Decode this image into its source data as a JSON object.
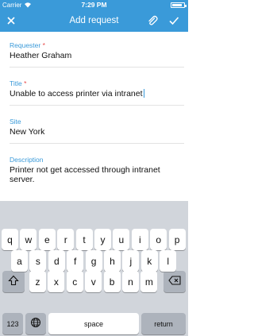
{
  "status_bar": {
    "carrier": "Carrier",
    "time": "7:29 PM",
    "battery_level": 0.85
  },
  "navbar": {
    "title": "Add request",
    "icons": [
      "close-icon",
      "paperclip-icon",
      "checkmark-icon"
    ],
    "accent": "#3a9ad9"
  },
  "form": {
    "requester": {
      "label": "Requester",
      "required_mark": "*",
      "value": "Heather Graham"
    },
    "title": {
      "label": "Title",
      "required_mark": "*",
      "value": "Unable to access printer via intranet"
    },
    "site": {
      "label": "Site",
      "value": "New York"
    },
    "description": {
      "label": "Description",
      "value": "Printer not get accessed through intranet server."
    }
  },
  "keyboard": {
    "row1": [
      "q",
      "w",
      "e",
      "r",
      "t",
      "y",
      "u",
      "i",
      "o",
      "p"
    ],
    "row2": [
      "a",
      "s",
      "d",
      "f",
      "g",
      "h",
      "j",
      "k",
      "l"
    ],
    "row3": [
      "z",
      "x",
      "c",
      "v",
      "b",
      "n",
      "m"
    ],
    "numbers_key": "123",
    "space_key": "space",
    "return_key": "return",
    "icons": [
      "shift-icon",
      "backspace-icon",
      "globe-icon"
    ]
  }
}
